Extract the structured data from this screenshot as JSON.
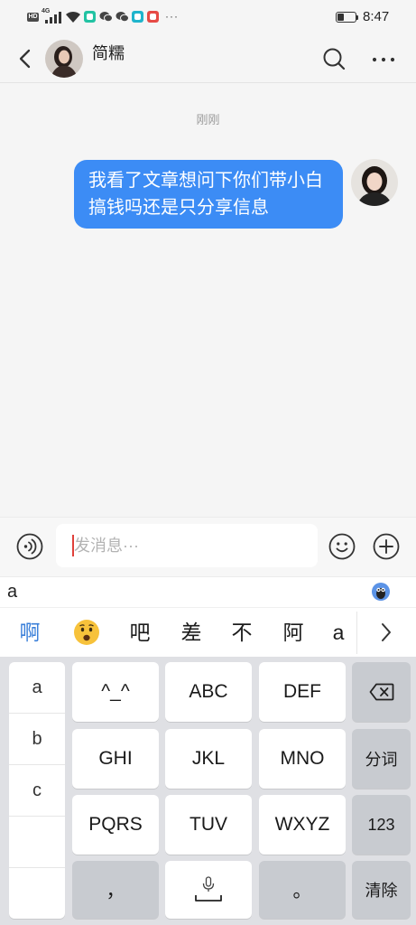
{
  "colors": {
    "bubble": "#3c8cf5",
    "candidate_highlight": "#3a7fd9",
    "caret": "#e0413b",
    "keyboard_bg": "#dfe0e4",
    "key": "#ffffff",
    "function_key": "#c8cbd0"
  },
  "status_bar": {
    "network_badge": "HD",
    "signal_type": "4G",
    "overflow_indicator": "···",
    "time": "8:47",
    "battery_level": 0.35,
    "icons": [
      "hd-icon",
      "signal-icon",
      "wifi-icon",
      "app-notification-icon",
      "wechat-icon",
      "wechat-icon",
      "app-notification-icon",
      "app-notification-icon",
      "battery-icon"
    ]
  },
  "header": {
    "contact_name": "简糯",
    "back_icon": "back-chevron-icon",
    "search_icon": "search-icon",
    "more_icon": "more-dots-icon"
  },
  "chat": {
    "timestamp": "刚刚",
    "messages": [
      {
        "direction": "outgoing",
        "text": "我看了文章想问下你们带小白搞钱吗还是只分享信息"
      }
    ]
  },
  "input_bar": {
    "placeholder": "发消息···",
    "voice_icon": "voice-input-icon",
    "emoji_icon": "emoji-icon",
    "plus_icon": "plus-icon"
  },
  "ime": {
    "composition": "a",
    "assistant_icon": "ime-assistant-icon",
    "candidates": [
      {
        "text": "啊",
        "highlighted": true
      },
      {
        "icon": "frowning-face-emoji"
      },
      {
        "text": "吧"
      },
      {
        "text": "差"
      },
      {
        "text": "不"
      },
      {
        "text": "阿"
      },
      {
        "text": "a"
      }
    ],
    "more_candidates_icon": "chevron-right-icon"
  },
  "keyboard": {
    "syllables": [
      "a",
      "b",
      "c"
    ],
    "rows": [
      [
        {
          "label": "^_^"
        },
        {
          "label": "ABC"
        },
        {
          "label": "DEF"
        },
        {
          "icon": "backspace-icon"
        }
      ],
      [
        {
          "label": "GHI"
        },
        {
          "label": "JKL"
        },
        {
          "label": "MNO"
        },
        {
          "label": "分词"
        }
      ],
      [
        {
          "label": "PQRS"
        },
        {
          "label": "TUV"
        },
        {
          "label": "WXYZ"
        },
        {
          "label": "123"
        }
      ],
      [
        {
          "label": "，"
        },
        {
          "icon": "space-key-icon"
        },
        {
          "label": "。"
        },
        {
          "label": "清除"
        }
      ]
    ]
  }
}
